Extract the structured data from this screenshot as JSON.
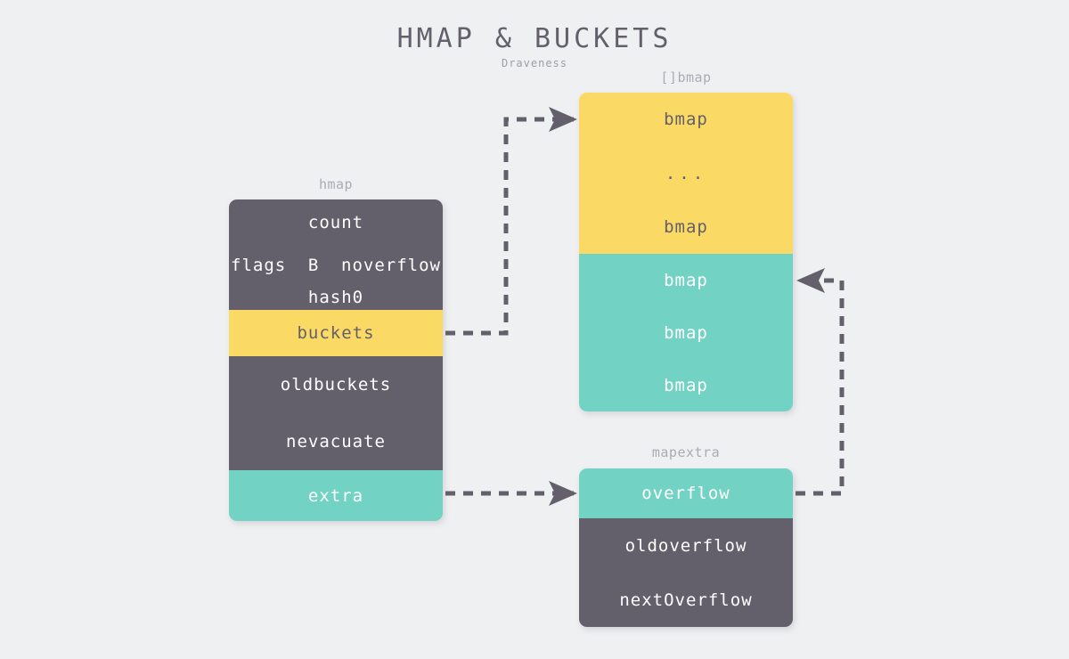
{
  "header": {
    "title": "HMAP & BUCKETS",
    "subtitle": "Draveness"
  },
  "colors": {
    "background": "#eff0f2",
    "dark": "#63606b",
    "yellow": "#fad964",
    "teal": "#72d2c4",
    "label_gray": "#a8adb4",
    "arrow": "#63606b"
  },
  "structs": {
    "hmap": {
      "label": "hmap",
      "rows": [
        {
          "text": "count",
          "color": "dark"
        },
        {
          "parts": [
            "flags",
            "B",
            "noverflow"
          ],
          "color": "dark"
        },
        {
          "text": "hash0",
          "color": "dark"
        },
        {
          "text": "buckets",
          "color": "yellow"
        },
        {
          "text": "oldbuckets",
          "color": "dark"
        },
        {
          "text": "nevacuate",
          "color": "dark"
        },
        {
          "text": "extra",
          "color": "teal"
        }
      ]
    },
    "bmap_array": {
      "label": "[]bmap",
      "rows": [
        {
          "text": "bmap",
          "color": "yellow"
        },
        {
          "text": "...",
          "color": "yellow"
        },
        {
          "text": "bmap",
          "color": "yellow"
        },
        {
          "text": "bmap",
          "color": "teal"
        },
        {
          "text": "bmap",
          "color": "teal"
        },
        {
          "text": "bmap",
          "color": "teal"
        }
      ]
    },
    "mapextra": {
      "label": "mapextra",
      "rows": [
        {
          "text": "overflow",
          "color": "teal"
        },
        {
          "text": "oldoverflow",
          "color": "dark"
        },
        {
          "text": "nextOverflow",
          "color": "dark"
        }
      ]
    }
  },
  "connectors": [
    {
      "name": "buckets-to-bmap-array",
      "from": "hmap.buckets",
      "to": "bmap_array"
    },
    {
      "name": "extra-to-mapextra",
      "from": "hmap.extra",
      "to": "mapextra.overflow"
    },
    {
      "name": "overflow-to-bmap-array",
      "from": "mapextra.overflow",
      "to": "bmap_array.bmap_overflow"
    }
  ]
}
